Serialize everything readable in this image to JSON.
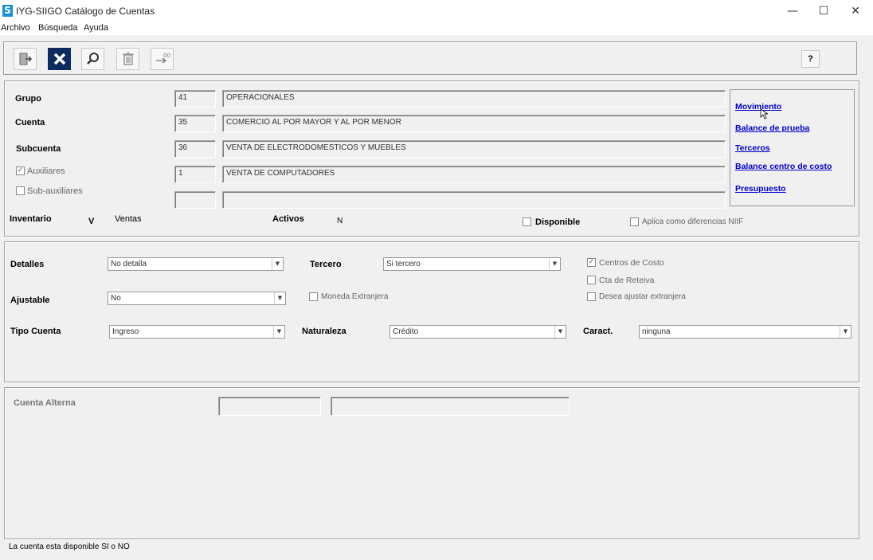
{
  "window": {
    "title": "IYG-SIIGO  Catálogo de Cuentas",
    "app_icon": "S"
  },
  "menu": [
    "Archivo",
    "Búsqueda",
    "Ayuda"
  ],
  "toolbar": {
    "help_label": "?"
  },
  "header": {
    "grupo": {
      "label": "Grupo",
      "code": "41",
      "name": "OPERACIONALES"
    },
    "cuenta": {
      "label": "Cuenta",
      "code": "35",
      "name": "COMERCIO AL POR MAYOR Y AL  POR MENOR"
    },
    "subcuenta": {
      "label": "Subcuenta",
      "code": "36",
      "name": "VENTA DE ELECTRODOMESTICOS Y MUEBLES"
    },
    "auxiliares": {
      "label": "Auxiliares",
      "code": "1",
      "name": "VENTA DE COMPUTADORES",
      "checked": true
    },
    "subauxiliares": {
      "label": "Sub-auxiliares",
      "code": "",
      "name": "",
      "checked": false
    },
    "inventario_label": "Inventario",
    "inventario_value": "V",
    "ventas_label": "Ventas",
    "activos_label": "Activos",
    "activos_value": "N",
    "disponible_label": "Disponible",
    "niif_label": "Aplica como diferencias NIIF"
  },
  "links": [
    "Movimiento",
    "Balance de prueba",
    "Terceros",
    "Balance centro de costo",
    "Presupuesto"
  ],
  "details": {
    "detalles_label": "Detalles",
    "detalles_value": "No detalla",
    "tercero_label": "Tercero",
    "tercero_value": "Si tercero",
    "ajustable_label": "Ajustable",
    "ajustable_value": "No",
    "moneda_label": "Moneda Extranjera",
    "centros_label": "Centros de Costo",
    "reteiva_label": "Cta de Reteiva",
    "ajustar_label": "Desea ajustar extranjera",
    "tipo_label": "Tipo Cuenta",
    "tipo_value": "Ingreso",
    "naturaleza_label": "Naturaleza",
    "naturaleza_value": "Crédito",
    "caract_label": "Caract.",
    "caract_value": "ninguna"
  },
  "alterna": {
    "label": "Cuenta Alterna",
    "code": "",
    "name": ""
  },
  "status": "La cuenta esta disponible SI o NO"
}
